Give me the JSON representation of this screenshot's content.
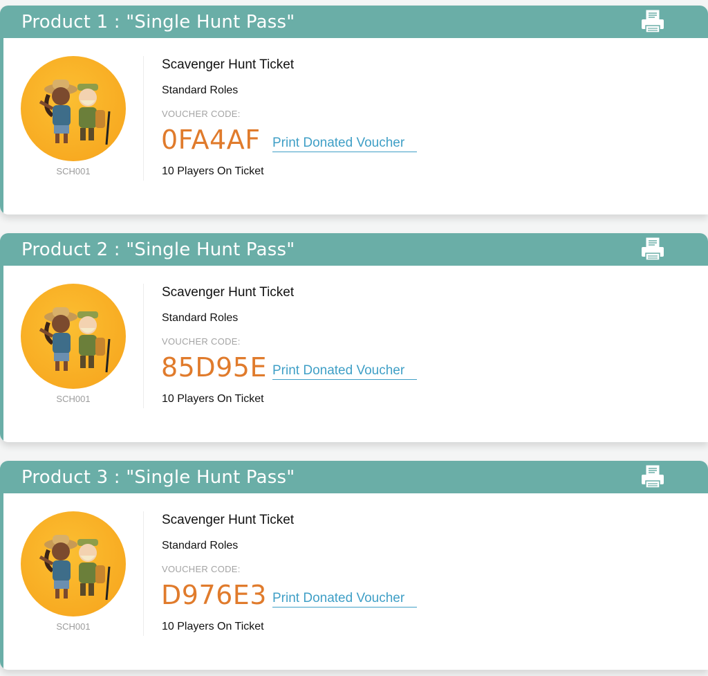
{
  "products": [
    {
      "title": "Product 1 : \"Single Hunt Pass\"",
      "sku": "SCH001",
      "ticket_name": "Scavenger Hunt Ticket",
      "roles": "Standard Roles",
      "voucher_label": "VOUCHER CODE:",
      "voucher_code": "0FA4AF",
      "print_link": "Print Donated Voucher",
      "players": "10 Players On Ticket",
      "print_icon": "printer-icon",
      "avatar": "explorers-avatar"
    },
    {
      "title": "Product 2 : \"Single Hunt Pass\"",
      "sku": "SCH001",
      "ticket_name": "Scavenger Hunt Ticket",
      "roles": "Standard Roles",
      "voucher_label": "VOUCHER CODE:",
      "voucher_code": "85D95E",
      "print_link": "Print Donated Voucher",
      "players": "10 Players On Ticket",
      "print_icon": "printer-icon",
      "avatar": "explorers-avatar"
    },
    {
      "title": "Product 3 : \"Single Hunt Pass\"",
      "sku": "SCH001",
      "ticket_name": "Scavenger Hunt Ticket",
      "roles": "Standard Roles",
      "voucher_label": "VOUCHER CODE:",
      "voucher_code": "D976E3",
      "print_link": "Print Donated Voucher",
      "players": "10 Players On Ticket",
      "print_icon": "printer-icon",
      "avatar": "explorers-avatar"
    }
  ],
  "colors": {
    "header": "#6aaea7",
    "voucher_code": "#e07b2c",
    "link": "#3f9fc6",
    "avatar_bg": "#f8ab22"
  }
}
